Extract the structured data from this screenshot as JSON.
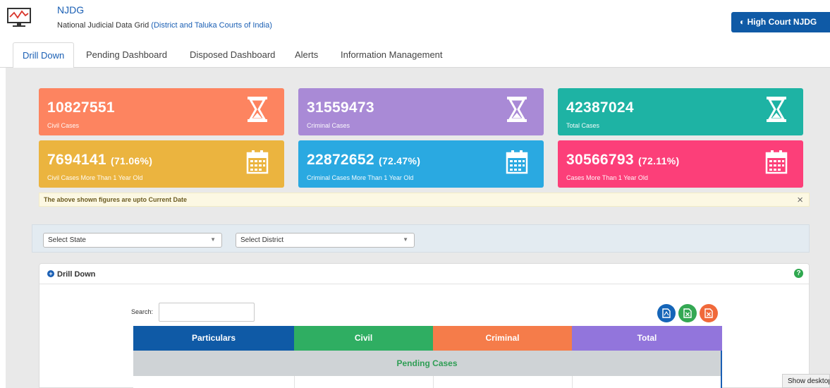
{
  "header": {
    "app_name": "NJDG",
    "subtitle_plain": "National Judicial Data Grid ",
    "subtitle_link": "(District and Taluka Courts of India)",
    "high_court_button": "High Court NJDG"
  },
  "tabs": [
    {
      "label": "Drill Down",
      "active": true
    },
    {
      "label": "Pending Dashboard",
      "active": false
    },
    {
      "label": "Disposed Dashboard",
      "active": false
    },
    {
      "label": "Alerts",
      "active": false
    },
    {
      "label": "Information Management",
      "active": false
    }
  ],
  "cards": [
    {
      "value": "10827551",
      "pct": "",
      "label": "Civil Cases",
      "color": "#fd8460",
      "icon": "hourglass-icon"
    },
    {
      "value": "31559473",
      "pct": "",
      "label": "Criminal Cases",
      "color": "#a98ad6",
      "icon": "hourglass-icon"
    },
    {
      "value": "42387024",
      "pct": "",
      "label": "Total Cases",
      "color": "#1eb3a4",
      "icon": "hourglass-icon"
    },
    {
      "value": "7694141",
      "pct": "(71.06%)",
      "label": "Civil Cases More Than 1 Year Old",
      "color": "#ebb43f",
      "icon": "calendar-icon"
    },
    {
      "value": "22872652",
      "pct": "(72.47%)",
      "label": "Criminal Cases More Than 1 Year Old",
      "color": "#2aa9e1",
      "icon": "calendar-icon"
    },
    {
      "value": "30566793",
      "pct": "(72.11%)",
      "label": "Cases More Than 1 Year Old",
      "color": "#fc3f79",
      "icon": "calendar-icon"
    }
  ],
  "notice": {
    "text": "The above shown figures are upto Current Date",
    "close": "×"
  },
  "filters": {
    "state_placeholder": "Select State",
    "district_placeholder": "Select District"
  },
  "drill_down": {
    "title": "Drill Down",
    "search_label": "Search:",
    "search_value": "",
    "columns": [
      {
        "label": "Particulars",
        "color": "#0f5aa6"
      },
      {
        "label": "Civil",
        "color": "#2fae62"
      },
      {
        "label": "Criminal",
        "color": "#f57c4a"
      },
      {
        "label": "Total",
        "color": "#9275dc"
      }
    ],
    "section_label": "Pending Cases",
    "export_colors": {
      "pdf": "#1565b8",
      "excel": "#34a853",
      "other": "#f0693a"
    }
  },
  "taskbar_tip": "Show desktop"
}
